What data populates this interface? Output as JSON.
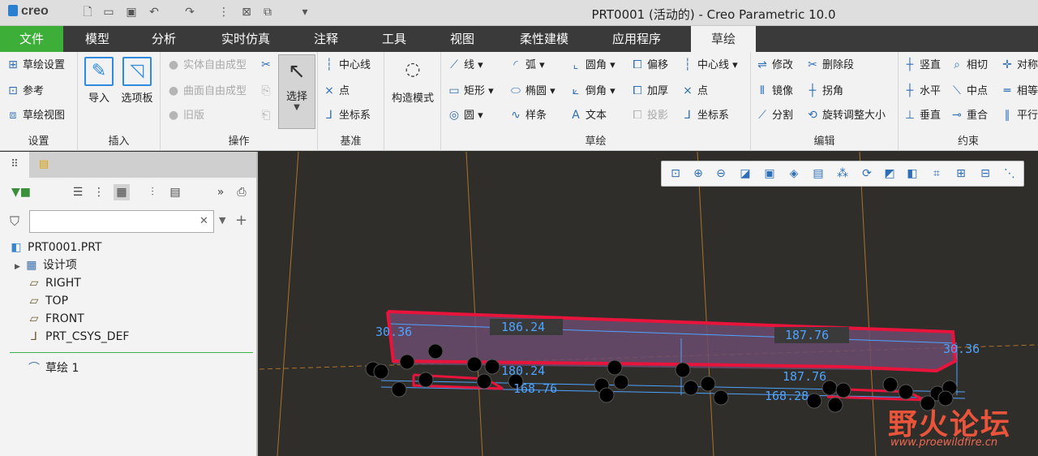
{
  "app": {
    "logo": "creo",
    "window_title": "PRT0001 (活动的) - Creo Parametric 10.0"
  },
  "quick_access": [
    "new-icon",
    "open-icon",
    "save-icon",
    "undo-icon",
    "redo-icon",
    "regenerate-icon",
    "close-window-icon",
    "switch-window-icon",
    "customize-icon"
  ],
  "tabs": [
    "文件",
    "模型",
    "分析",
    "实时仿真",
    "注释",
    "工具",
    "视图",
    "柔性建模",
    "应用程序",
    "草绘"
  ],
  "ribbon": {
    "setup": {
      "label": "设置",
      "items": [
        "草绘设置",
        "参考",
        "草绘视图"
      ]
    },
    "insert": {
      "label": "插入",
      "import": "导入",
      "palette": "选项板"
    },
    "operations": {
      "label": "操作",
      "items": [
        "实体自由成型",
        "曲面自由成型",
        "旧版"
      ],
      "select": "选择"
    },
    "datum": {
      "label": "基准",
      "items": [
        "中心线",
        "点",
        "坐标系"
      ]
    },
    "construction": {
      "label": "构造模式"
    },
    "sketch": {
      "label": "草绘",
      "col1": [
        "线",
        "矩形",
        "圆"
      ],
      "col2": [
        "弧",
        "椭圆",
        "样条"
      ],
      "col3": [
        "圆角",
        "倒角",
        "文本"
      ],
      "col4": [
        "偏移",
        "加厚",
        "投影"
      ],
      "col5": [
        "中心线",
        "点",
        "坐标系"
      ]
    },
    "edit": {
      "label": "编辑",
      "col1": [
        "修改",
        "镜像",
        "分割"
      ],
      "col2": [
        "删除段",
        "拐角",
        "旋转调整大小"
      ]
    },
    "constrain": {
      "label": "约束",
      "col1": [
        "竖直",
        "水平",
        "垂直"
      ],
      "col2": [
        "相切",
        "中点",
        "重合"
      ],
      "col3": [
        "对称",
        "相等",
        "平行"
      ]
    }
  },
  "model_tree": {
    "search_placeholder": "",
    "items": [
      {
        "label": "PRT0001.PRT",
        "icon": "part-icon"
      },
      {
        "label": "设计项",
        "icon": "design-items-icon"
      },
      {
        "label": "RIGHT",
        "icon": "datum-plane-icon"
      },
      {
        "label": "TOP",
        "icon": "datum-plane-icon"
      },
      {
        "label": "FRONT",
        "icon": "datum-plane-icon"
      },
      {
        "label": "PRT_CSYS_DEF",
        "icon": "csys-icon"
      },
      {
        "label": "草绘 1",
        "icon": "sketch-icon"
      }
    ]
  },
  "sketch_dims": [
    "186.24",
    "187.76",
    "30.36",
    "30.36",
    "168.76",
    "168.28",
    "180.24",
    "187.76"
  ],
  "watermark": {
    "text": "野火论坛",
    "url": "www.proewildfire.cn"
  },
  "colors": {
    "file_tab": "#3dae38",
    "sketch_red": "#e8143c",
    "dim_blue": "#4da3ff",
    "fill_purple": "#6b4b6e"
  }
}
